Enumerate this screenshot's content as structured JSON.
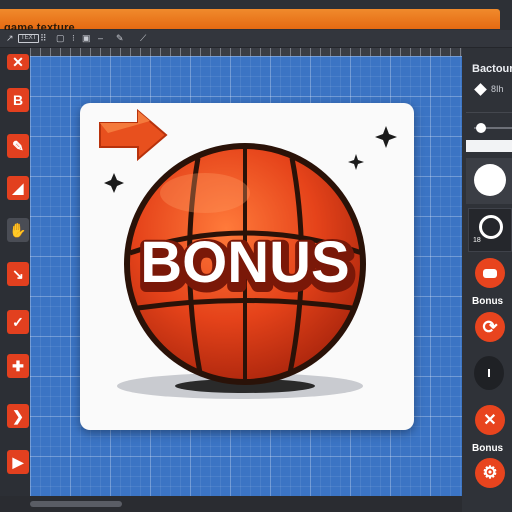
{
  "window": {
    "title": "game texture"
  },
  "toolbar": {
    "box_label": "TEXT"
  },
  "artwork": {
    "text": "BONUS"
  },
  "right_panel": {
    "heading": "Bactour",
    "value": "8Ih",
    "size_value": "18",
    "label_1": "Bonus",
    "label_2": "Bonus"
  },
  "colors": {
    "accent": "#e56a12",
    "canvas": "#3b74c4",
    "ball": "#e5431a",
    "tool_red": "#e2401f"
  },
  "icons": [
    "arrow-icon",
    "sparkle-icon",
    "close-icon",
    "refresh-icon",
    "gear-icon"
  ]
}
